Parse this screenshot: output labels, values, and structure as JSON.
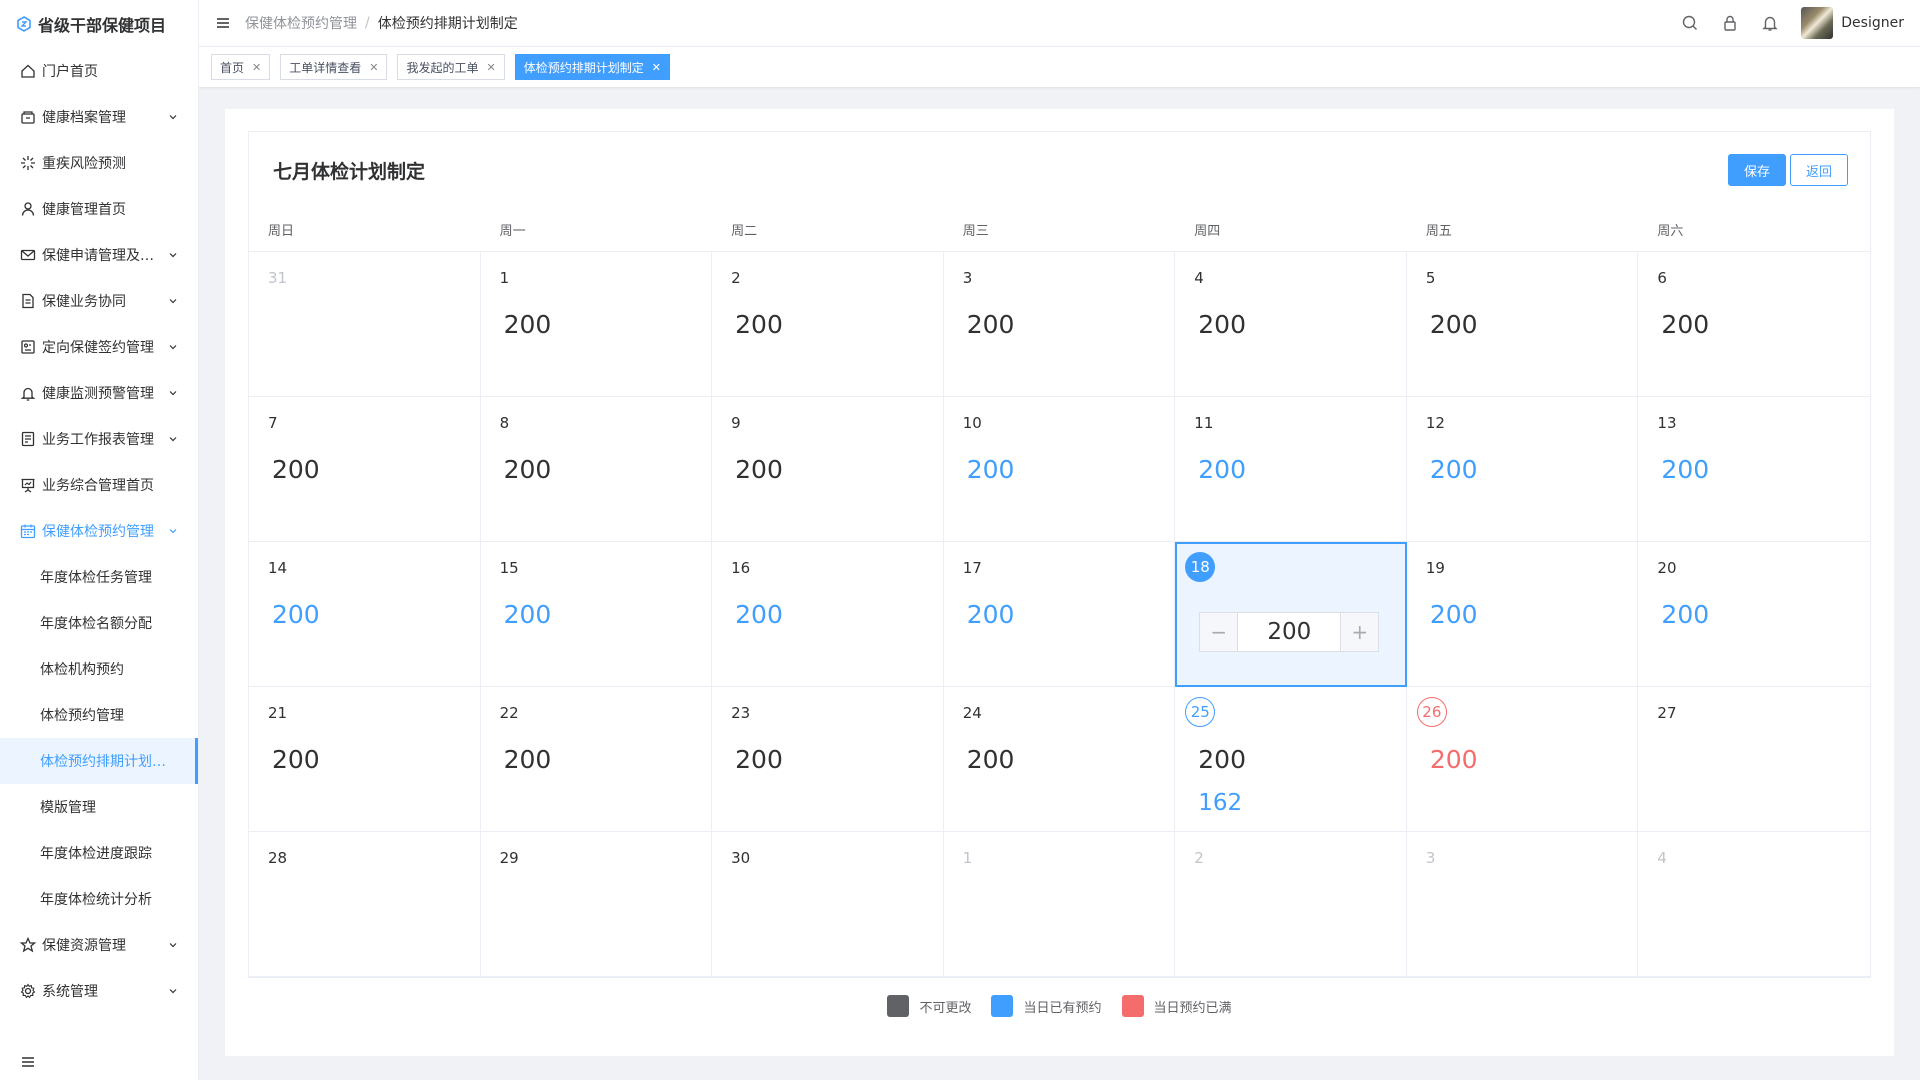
{
  "app": {
    "title": "省级干部保健项目"
  },
  "sidebar": {
    "items": [
      {
        "label": "门户首页",
        "icon": "home-icon",
        "has_children": false
      },
      {
        "label": "健康档案管理",
        "icon": "archive-box-icon",
        "has_children": true
      },
      {
        "label": "重疾风险预测",
        "icon": "sparkle-icon",
        "has_children": false
      },
      {
        "label": "健康管理首页",
        "icon": "user-icon",
        "has_children": false
      },
      {
        "label": "保健申请管理及…",
        "icon": "mail-icon",
        "has_children": true
      },
      {
        "label": "保健业务协同",
        "icon": "document-icon",
        "has_children": true
      },
      {
        "label": "定向保健签约管理",
        "icon": "contract-icon",
        "has_children": true
      },
      {
        "label": "健康监测预警管理",
        "icon": "bell-icon",
        "has_children": true
      },
      {
        "label": "业务工作报表管理",
        "icon": "report-icon",
        "has_children": true
      },
      {
        "label": "业务综合管理首页",
        "icon": "presentation-icon",
        "has_children": false
      },
      {
        "label": "保健体检预约管理",
        "icon": "calendar-icon",
        "has_children": true,
        "open": true
      }
    ],
    "submenu": [
      {
        "label": "年度体检任务管理"
      },
      {
        "label": "年度体检名额分配"
      },
      {
        "label": "体检机构预约"
      },
      {
        "label": "体检预约管理"
      },
      {
        "label": "体检预约排期计划制定",
        "active": true
      },
      {
        "label": "模版管理"
      },
      {
        "label": "年度体检进度跟踪"
      },
      {
        "label": "年度体检统计分析"
      }
    ],
    "after": [
      {
        "label": "保健资源管理",
        "icon": "star-icon",
        "has_children": true
      },
      {
        "label": "系统管理",
        "icon": "gear-icon",
        "has_children": true
      }
    ]
  },
  "header": {
    "breadcrumb": {
      "parent": "保健体检预约管理",
      "separator": "/",
      "current": "体检预约排期计划制定"
    },
    "username": "Designer"
  },
  "tags": [
    {
      "label": "首页",
      "active": false
    },
    {
      "label": "工单详情查看",
      "active": false
    },
    {
      "label": "我发起的工单",
      "active": false
    },
    {
      "label": "体检预约排期计划制定",
      "active": true
    }
  ],
  "page": {
    "title": "七月体检计划制定",
    "save_label": "保存",
    "back_label": "返回"
  },
  "calendar": {
    "weekdays": [
      "周日",
      "周一",
      "周二",
      "周三",
      "周四",
      "周五",
      "周六"
    ],
    "cells": [
      {
        "day": "31",
        "other": true
      },
      {
        "day": "1",
        "qty": "200",
        "status": "normal"
      },
      {
        "day": "2",
        "qty": "200",
        "status": "normal"
      },
      {
        "day": "3",
        "qty": "200",
        "status": "normal"
      },
      {
        "day": "4",
        "qty": "200",
        "status": "normal"
      },
      {
        "day": "5",
        "qty": "200",
        "status": "normal"
      },
      {
        "day": "6",
        "qty": "200",
        "status": "normal"
      },
      {
        "day": "7",
        "qty": "200",
        "status": "normal"
      },
      {
        "day": "8",
        "qty": "200",
        "status": "normal"
      },
      {
        "day": "9",
        "qty": "200",
        "status": "normal"
      },
      {
        "day": "10",
        "qty": "200",
        "status": "blue"
      },
      {
        "day": "11",
        "qty": "200",
        "status": "blue"
      },
      {
        "day": "12",
        "qty": "200",
        "status": "blue"
      },
      {
        "day": "13",
        "qty": "200",
        "status": "blue"
      },
      {
        "day": "14",
        "qty": "200",
        "status": "blue"
      },
      {
        "day": "15",
        "qty": "200",
        "status": "blue"
      },
      {
        "day": "16",
        "qty": "200",
        "status": "blue"
      },
      {
        "day": "17",
        "qty": "200",
        "status": "blue"
      },
      {
        "day": "18",
        "qty": "200",
        "status": "editing",
        "circle": "filled"
      },
      {
        "day": "19",
        "qty": "200",
        "status": "blue"
      },
      {
        "day": "20",
        "qty": "200",
        "status": "blue"
      },
      {
        "day": "21",
        "qty": "200",
        "status": "normal"
      },
      {
        "day": "22",
        "qty": "200",
        "status": "normal"
      },
      {
        "day": "23",
        "qty": "200",
        "status": "normal"
      },
      {
        "day": "24",
        "qty": "200",
        "status": "normal"
      },
      {
        "day": "25",
        "qty": "200",
        "status": "normal",
        "booked": "162",
        "circle": "outline-blue"
      },
      {
        "day": "26",
        "qty": "200",
        "status": "red",
        "circle": "outline-red"
      },
      {
        "day": "27"
      },
      {
        "day": "28"
      },
      {
        "day": "29"
      },
      {
        "day": "30"
      },
      {
        "day": "1",
        "other": true
      },
      {
        "day": "2",
        "other": true
      },
      {
        "day": "3",
        "other": true
      },
      {
        "day": "4",
        "other": true
      }
    ]
  },
  "stepper": {
    "minus": "−",
    "value": "200",
    "plus": "+"
  },
  "legend": [
    {
      "label": "不可更改",
      "color": "#606266"
    },
    {
      "label": "当日已有预约",
      "color": "#409eff"
    },
    {
      "label": "当日预约已满",
      "color": "#f56c6c"
    }
  ],
  "colors": {
    "accent": "#409eff",
    "danger": "#f56c6c"
  }
}
